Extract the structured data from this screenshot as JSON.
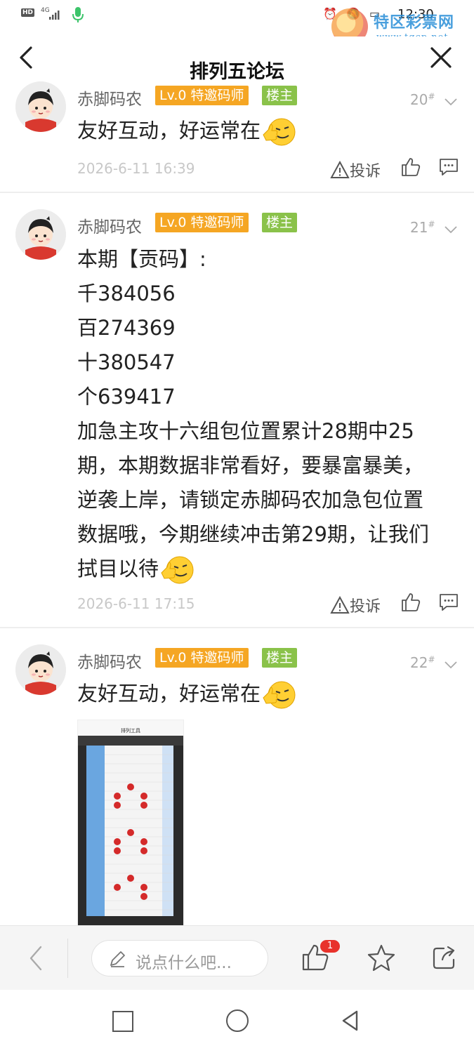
{
  "status_bar": {
    "hd": "HD",
    "network": "4G",
    "time": "12:30"
  },
  "watermark": {
    "text": "特区彩票网",
    "url": "www.tqcp.net"
  },
  "header": {
    "title": "排列五论坛"
  },
  "posts": [
    {
      "username": "赤脚码农",
      "level_badge": "Lv.0 特邀码师",
      "host_badge": "楼主",
      "floor": "20",
      "content_lines": [
        "友好互动，好运常在"
      ],
      "time": "2026-6-11 16:39",
      "report_label": "投诉"
    },
    {
      "username": "赤脚码农",
      "level_badge": "Lv.0 特邀码师",
      "host_badge": "楼主",
      "floor": "21",
      "content_lines": [
        "本期【贡码】:",
        "千384056",
        "百274369",
        "十380547",
        "个639417",
        "加急主攻十六组包位置累计28期中25",
        "期，本期数据非常看好，要暴富暴美，",
        "逆袭上岸，请锁定赤脚码农加急包位置",
        "数据哦，今期继续冲击第29期，让我们",
        "拭目以待"
      ],
      "time": "2026-6-11 17:15",
      "report_label": "投诉"
    },
    {
      "username": "赤脚码农",
      "level_badge": "Lv.0 特邀码师",
      "host_badge": "楼主",
      "floor": "22",
      "content_lines": [
        "友好互动，好运常在"
      ],
      "thumb_title": "排列工具"
    }
  ],
  "bottom_bar": {
    "comment_placeholder": "说点什么吧...",
    "like_count": "1"
  },
  "colors": {
    "level_badge": "#f5a623",
    "host_badge": "#8ac24a",
    "like_badge": "#e8322b"
  }
}
